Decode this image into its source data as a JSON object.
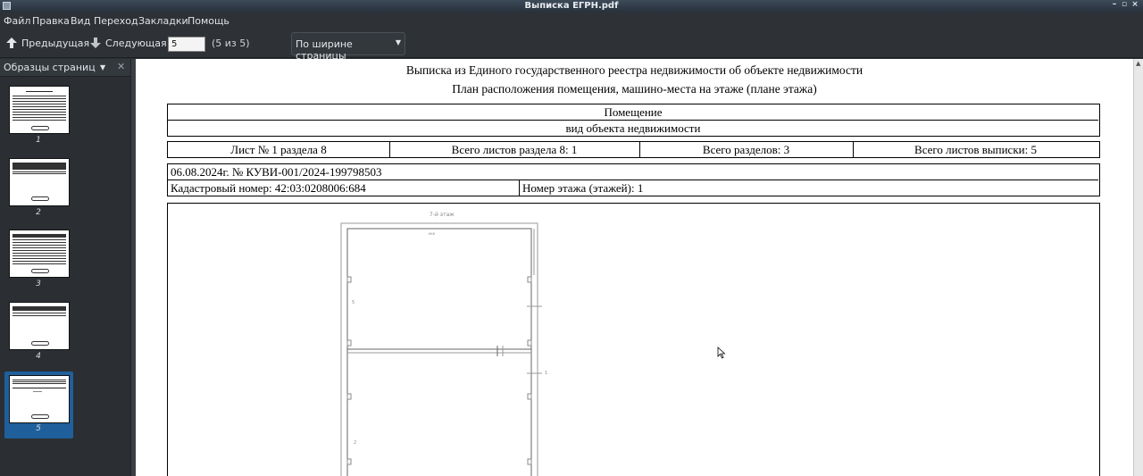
{
  "window": {
    "title": "Выписка ЕГРН.pdf",
    "minimize": "–",
    "maximize": "▫",
    "close": "×"
  },
  "menu": {
    "file": "Файл",
    "edit": "Правка",
    "view": "Вид",
    "go": "Переход",
    "bookmarks": "Закладки",
    "help": "Помощь"
  },
  "toolbar": {
    "prev_label": "Предыдущая",
    "next_label": "Следующая",
    "page_value": "5",
    "page_count": "(5 из 5)",
    "zoom_value": "По ширине страницы"
  },
  "sidebar": {
    "title": "Образцы страниц",
    "thumbnails": [
      {
        "number": "1"
      },
      {
        "number": "2"
      },
      {
        "number": "3"
      },
      {
        "number": "4"
      },
      {
        "number": "5"
      }
    ],
    "selected_page": 5
  },
  "document": {
    "heading1": "Выписка из Единого государственного реестра недвижимости об объекте недвижимости",
    "heading2": "План расположения помещения, машино-места на этаже (плане этажа)",
    "object_kind_title": "Помещение",
    "object_kind_subtitle": "вид объекта недвижимости",
    "sheet": "Лист № 1 раздела 8",
    "sheets_in_section": "Всего листов раздела 8: 1",
    "sections_total": "Всего разделов: 3",
    "sheets_total": "Всего листов выписки: 5",
    "date_number": "06.08.2024г. № КУВИ-001/2024-199798503",
    "cadastral_number": "Кадастровый номер: 42:03:0208006:684",
    "floor_number": "Номер этажа (этажей): 1",
    "plan_label_floor": "7-й этаж",
    "plan_label_top": "ккк",
    "plan_mark_1": "5",
    "plan_mark_2": "2",
    "plan_mark_3": "1"
  }
}
